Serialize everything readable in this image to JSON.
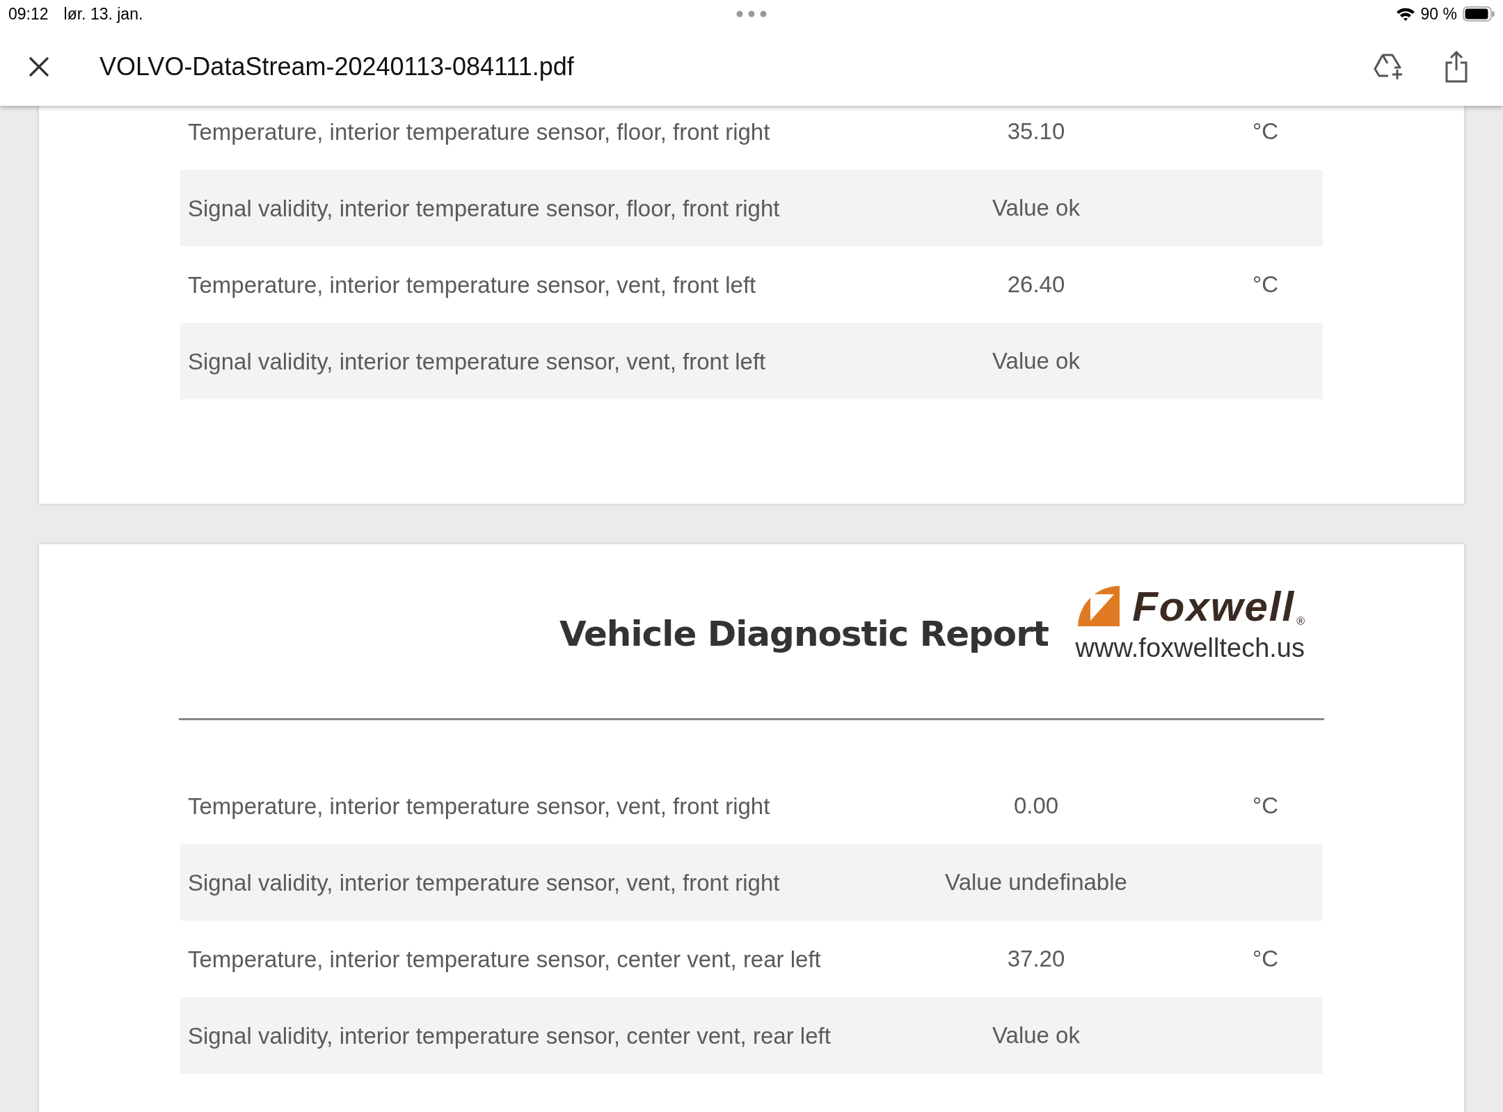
{
  "status_bar": {
    "time": "09:12",
    "date": "lør. 13. jan.",
    "battery": "90 %"
  },
  "header": {
    "title": "VOLVO-DataStream-20240113-084111.pdf"
  },
  "pages": [
    {
      "rows": [
        {
          "label": "Temperature, interior temperature sensor, floor, front right",
          "value": "35.10",
          "unit": "°C"
        },
        {
          "label": "Signal validity, interior temperature sensor, floor, front right",
          "value": "Value ok"
        },
        {
          "label": "Temperature, interior temperature sensor, vent, front left",
          "value": "26.40",
          "unit": "°C"
        },
        {
          "label": "Signal validity, interior temperature sensor, vent, front left",
          "value": "Value ok"
        }
      ]
    },
    {
      "report": {
        "title": "Vehicle Diagnostic Report",
        "brand": "Foxwell",
        "registered": "®",
        "url": "www.foxwelltech.us"
      },
      "rows": [
        {
          "label": "Temperature, interior temperature sensor, vent, front right",
          "value": "0.00",
          "unit": "°C"
        },
        {
          "label": "Signal validity, interior temperature sensor, vent, front right",
          "value": "Value undefinable"
        },
        {
          "label": "Temperature, interior temperature sensor, center vent, rear left",
          "value": "37.20",
          "unit": "°C"
        },
        {
          "label": "Signal validity, interior temperature sensor, center vent, rear left",
          "value": "Value ok"
        }
      ]
    }
  ]
}
